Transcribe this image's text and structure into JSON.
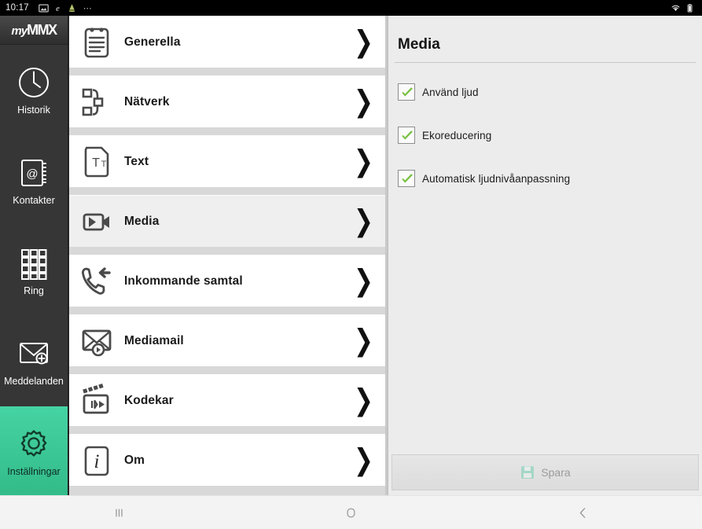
{
  "statusbar": {
    "clock": "10:17",
    "left_icons": [
      "image-icon",
      "edge-browser-icon",
      "download-icon"
    ],
    "overflow": "⋯",
    "right_icons": [
      "wifi-icon",
      "battery-icon"
    ]
  },
  "sidebar": {
    "brand_my": "my",
    "brand_mmx": "MMX",
    "items": [
      {
        "label": "Historik",
        "icon": "clock-icon",
        "active": false
      },
      {
        "label": "Kontakter",
        "icon": "contacts-icon",
        "active": false
      },
      {
        "label": "Ring",
        "icon": "keypad-icon",
        "active": false
      },
      {
        "label": "Meddelanden",
        "icon": "message-icon",
        "active": false
      },
      {
        "label": "Inställningar",
        "icon": "gear-icon",
        "active": true
      }
    ],
    "active_color": "#3fc998"
  },
  "settings_list": {
    "rows": [
      {
        "label": "Generella",
        "icon": "notepad-icon",
        "selected": false,
        "chevron": "❯"
      },
      {
        "label": "Nätverk",
        "icon": "network-icon",
        "selected": false,
        "chevron": "❯"
      },
      {
        "label": "Text",
        "icon": "text-file-icon",
        "selected": false,
        "chevron": "❯"
      },
      {
        "label": "Media",
        "icon": "video-cam-icon",
        "selected": true,
        "chevron": "❯"
      },
      {
        "label": "Inkommande samtal",
        "icon": "incoming-call-icon",
        "selected": false,
        "chevron": "❯"
      },
      {
        "label": "Mediamail",
        "icon": "mediamail-icon",
        "selected": false,
        "chevron": "❯"
      },
      {
        "label": "Kodekar",
        "icon": "clapperboard-icon",
        "selected": false,
        "chevron": "❯"
      },
      {
        "label": "Om",
        "icon": "info-icon",
        "selected": false,
        "chevron": "❯"
      }
    ]
  },
  "detail": {
    "title": "Media",
    "checkboxes": [
      {
        "label": "Använd ljud",
        "checked": true
      },
      {
        "label": "Ekoreducering",
        "checked": true
      },
      {
        "label": "Automatisk ljudnivåanpassning",
        "checked": true
      }
    ],
    "check_color": "#7ac043",
    "save": {
      "label": "Spara",
      "icon": "save-disk-icon",
      "enabled": false
    }
  },
  "android_nav": {
    "recents": "recents-icon",
    "home": "home-icon",
    "back": "back-icon"
  }
}
